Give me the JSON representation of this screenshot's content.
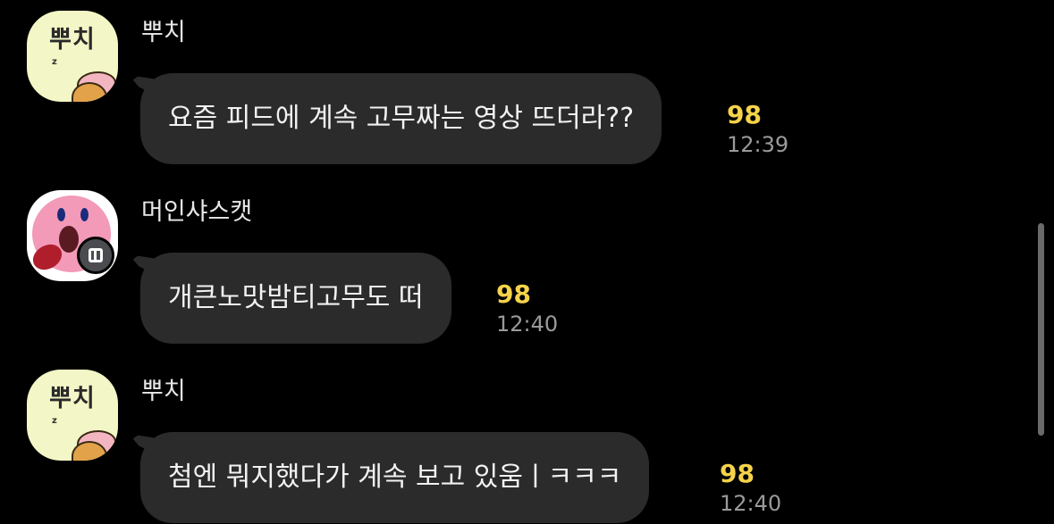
{
  "messages": [
    {
      "sender": "뿌치",
      "avatar_text": "뿌치",
      "avatar_zz": "z",
      "text": "요즘 피드에 계속 고무짜는 영상 뜨더라??",
      "unread": "98",
      "time": "12:39"
    },
    {
      "sender": "머인샤스캣",
      "text": "개큰노맛밤티고무도 떠",
      "unread": "98",
      "time": "12:40"
    },
    {
      "sender": "뿌치",
      "avatar_text": "뿌치",
      "avatar_zz": "z",
      "text": "첨엔 뭐지했다가 계속 보고 있움ㅣㅋㅋㅋ",
      "unread": "98",
      "time": "12:40"
    }
  ],
  "icons": {
    "badge": "open-chat-profile-badge-icon",
    "kirby_avatar": "kirby-avatar-icon",
    "ryan_avatar": "ryan-sleeping-avatar-icon"
  },
  "colors": {
    "background": "#000000",
    "bubble": "#2b2b2b",
    "unread": "#f5d34a",
    "time": "#9a9a9a",
    "name": "#e8e8e8"
  }
}
